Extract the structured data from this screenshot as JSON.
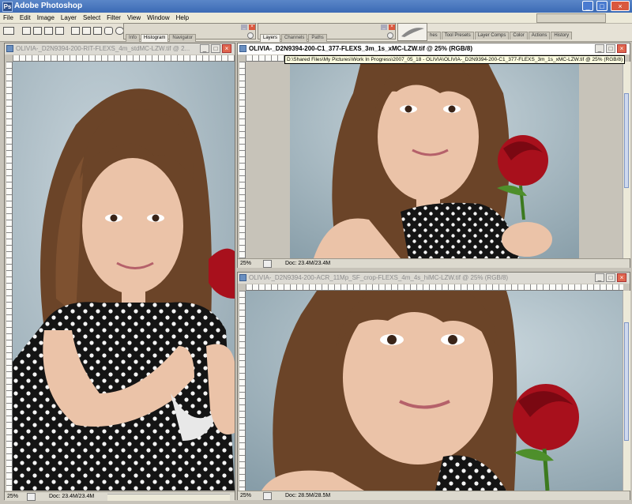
{
  "app": {
    "title": "Adobe Photoshop",
    "icon": "Ps",
    "window_buttons": {
      "minimize": "_",
      "maximize": "□",
      "close": "×"
    }
  },
  "menu": [
    "File",
    "Edit",
    "Image",
    "Layer",
    "Select",
    "Filter",
    "View",
    "Window",
    "Help"
  ],
  "palettes": {
    "info_group_tabs": [
      "Info",
      "Histogram",
      "Navigator"
    ],
    "layers_group_tabs": [
      "Layers",
      "Channels",
      "Paths"
    ],
    "well_tabs": [
      "Brushes",
      "Tool Presets",
      "Layer Comps",
      "Color",
      "Actions",
      "History"
    ],
    "well_tab_partial": "hes"
  },
  "documents": [
    {
      "title": "OLIVIA-_D2N9394-200-RIT-FLEXS_4m_stdMC-LZW.tif @ 2...",
      "zoom": "25%",
      "doc": "Doc: 23.4M/23.4M",
      "active": false
    },
    {
      "title": "OLIVIA-_D2N9394-200-C1_377-FLEXS_3m_1s_xMC-LZW.tif @ 25% (RGB/8)",
      "zoom": "25%",
      "doc": "Doc: 23.4M/23.4M",
      "active": true,
      "tooltip": "D:\\Shared Files\\My Pictures\\Work In Progress\\2007_05_18 - OLIVIA\\OLIVIA-_D2N9394-200-C1_377-FLEXS_3m_1s_xMC-LZW.tif @ 25% (RGB/8)"
    },
    {
      "title": "OLIVIA-_D2N9394-200-ACR_11Mp_SF_crop-FLEXS_4m_4s_hiMC-LZW.tif @ 25% (RGB/8)",
      "zoom": "25%",
      "doc": "Doc: 28.5M/28.5M",
      "active": false
    }
  ],
  "colors": {
    "backdrop": "#c7c3b9",
    "title_bar": "#3c6bb5",
    "photo_background": "#9fb3c0",
    "hair": "#6b4428",
    "skin": "#e9bfa4",
    "dress": "#141414",
    "rose": "#a8101c"
  }
}
